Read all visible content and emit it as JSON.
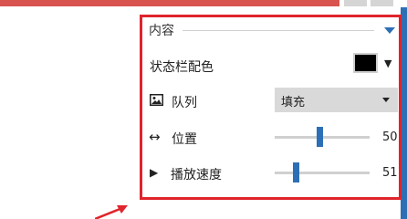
{
  "section": {
    "title": "内容",
    "toggle_icon": "triangle-down-icon"
  },
  "status_bar_color": {
    "label": "状态栏配色",
    "value_color": "#000000",
    "dropdown_icon": "▼"
  },
  "queue": {
    "icon": "image-icon",
    "label": "队列",
    "selected": "填充"
  },
  "position": {
    "icon": "↔",
    "label": "位置",
    "value": "50"
  },
  "playback_speed": {
    "icon": "▶",
    "label": "播放速度",
    "value": "51"
  },
  "colors": {
    "highlight_border": "#e0242c",
    "accent": "#2d6fb5"
  }
}
